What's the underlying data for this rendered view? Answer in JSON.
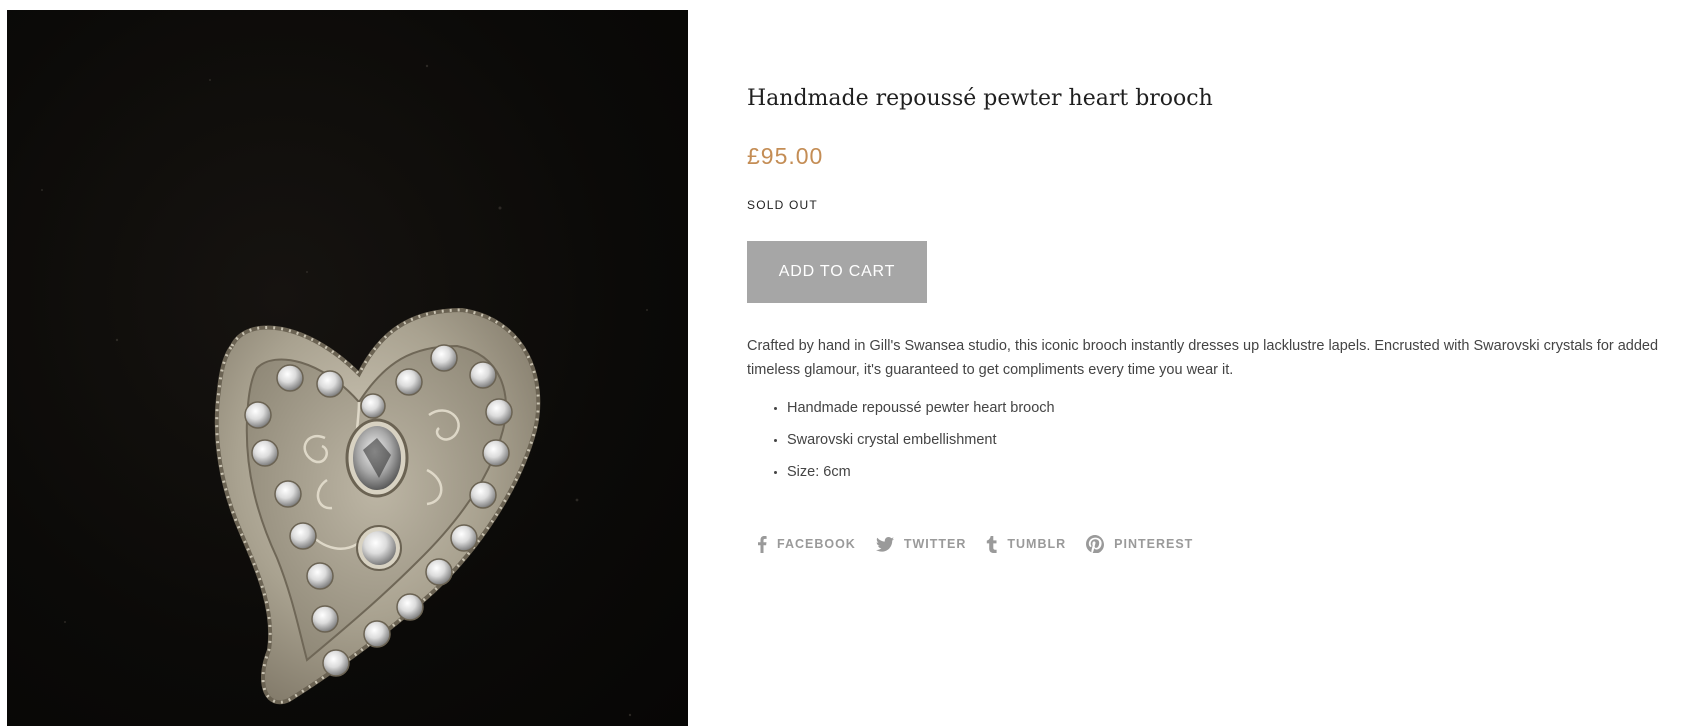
{
  "product": {
    "title": "Handmade repoussé pewter heart brooch",
    "price": "£95.00",
    "stock_status": "SOLD OUT",
    "add_to_cart_label": "ADD TO CART",
    "description": "Crafted by hand in Gill's Swansea studio, this iconic brooch instantly dresses up lacklustre lapels. Encrusted with Swarovski crystals for added timeless glamour, it's guaranteed to get compliments every time you wear it.",
    "features": [
      "Handmade repoussé pewter heart brooch",
      "Swarovski crystal embellishment",
      "Size: 6cm"
    ]
  },
  "share": {
    "links": [
      {
        "label": "FACEBOOK",
        "icon": "facebook-icon"
      },
      {
        "label": "TWITTER",
        "icon": "twitter-icon"
      },
      {
        "label": "TUMBLR",
        "icon": "tumblr-icon"
      },
      {
        "label": "PINTEREST",
        "icon": "pinterest-icon"
      }
    ]
  },
  "colors": {
    "price": "#c48d55",
    "button": "#a6a6a6",
    "share_links": "#9a9a9a",
    "image_background": "#0b0a08"
  }
}
